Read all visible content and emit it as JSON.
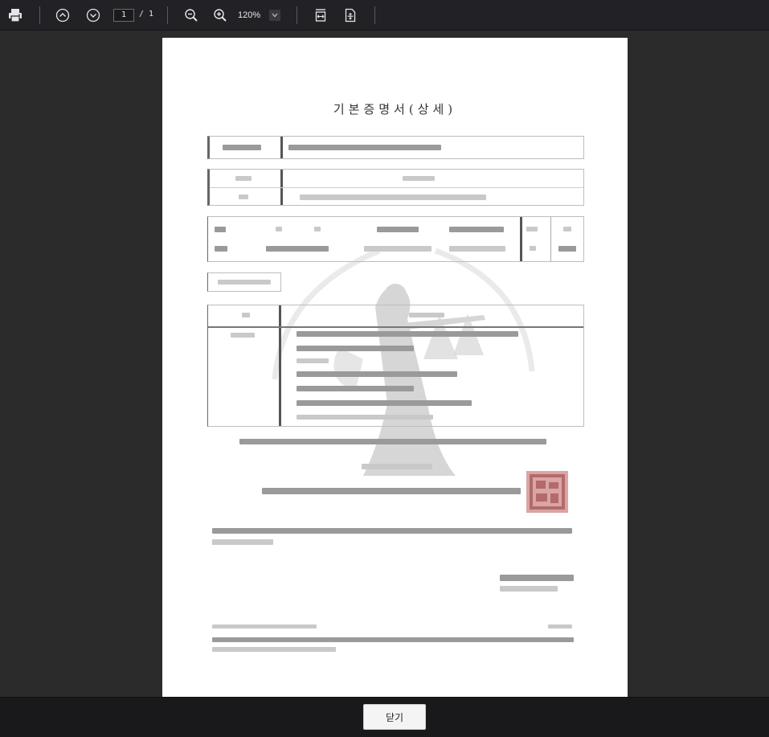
{
  "toolbar": {
    "current_page": "1",
    "page_total": "/ 1",
    "zoom_level": "120%"
  },
  "document": {
    "title": "기본증명서(상세)"
  },
  "footer": {
    "close_label": "닫기"
  }
}
